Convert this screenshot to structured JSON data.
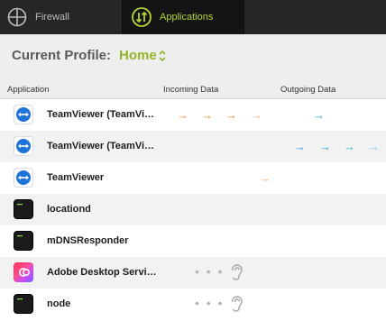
{
  "tabs": [
    {
      "label": "Firewall",
      "icon": "globe-icon",
      "active": false
    },
    {
      "label": "Applications",
      "icon": "traffic-arrows-icon",
      "active": true
    }
  ],
  "profile": {
    "label": "Current Profile:",
    "value": "Home"
  },
  "columns": {
    "application": "Application",
    "incoming": "Incoming Data",
    "outgoing": "Outgoing Data"
  },
  "rows": [
    {
      "name": "TeamViewer (TeamViewer)",
      "icon": "teamviewer-icon"
    },
    {
      "name": "TeamViewer (TeamViewer)",
      "icon": "teamviewer-icon"
    },
    {
      "name": "TeamViewer",
      "icon": "teamviewer-icon"
    },
    {
      "name": "locationd",
      "icon": "terminal-icon"
    },
    {
      "name": "mDNSResponder",
      "icon": "terminal-icon"
    },
    {
      "name": "Adobe Desktop Service",
      "icon": "creative-cloud-icon"
    },
    {
      "name": "node",
      "icon": "terminal-icon"
    }
  ],
  "colors": {
    "accent": "#b5d334",
    "profile_value": "#93b52a",
    "incoming_arrow": "#ee8c30",
    "outgoing_arrow": "#36a8dc"
  }
}
